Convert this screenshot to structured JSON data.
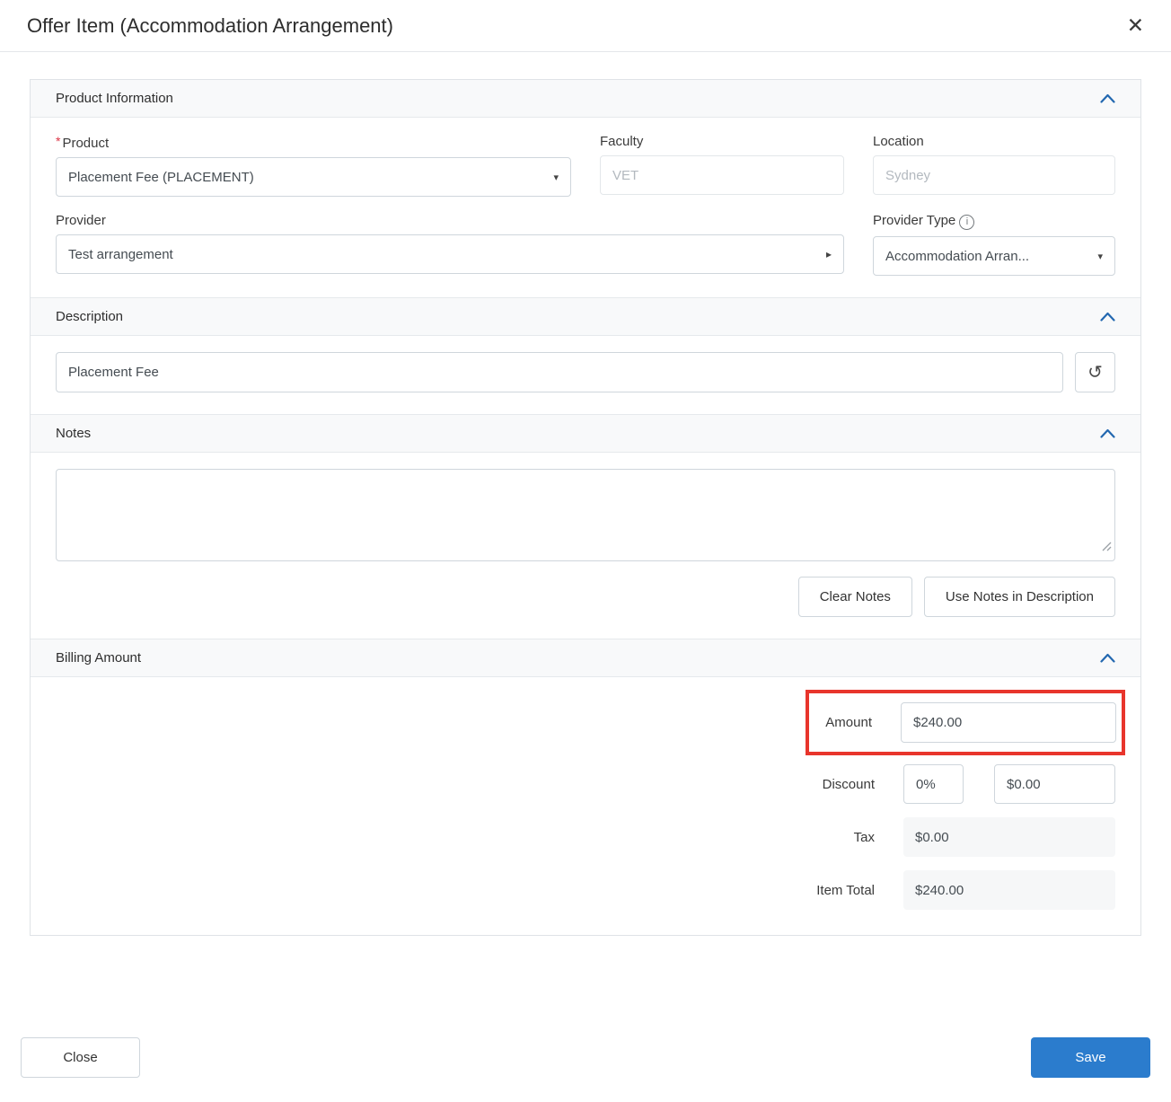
{
  "colors": {
    "accent_blue": "#2b7ccd",
    "chevron_blue": "#2368b0",
    "highlight_red": "#e8352c",
    "section_header_bg": "#f8f9fa"
  },
  "icons": {
    "close": "✕",
    "caret_down": "▾",
    "caret_right": "▸",
    "info": "i",
    "history": "↺"
  },
  "modal": {
    "title": "Offer Item (Accommodation Arrangement)"
  },
  "product_information": {
    "header": "Product Information",
    "product": {
      "label": "Product",
      "required": "*",
      "value": "Placement Fee (PLACEMENT)"
    },
    "faculty": {
      "label": "Faculty",
      "value": "VET"
    },
    "location": {
      "label": "Location",
      "value": "Sydney"
    },
    "provider": {
      "label": "Provider",
      "value": "Test arrangement"
    },
    "provider_type": {
      "label": "Provider Type",
      "value": "Accommodation Arran..."
    }
  },
  "description": {
    "header": "Description",
    "value": "Placement Fee"
  },
  "notes": {
    "header": "Notes",
    "value": "",
    "clear_button": "Clear Notes",
    "use_button": "Use Notes in Description"
  },
  "billing": {
    "header": "Billing Amount",
    "amount_label": "Amount",
    "amount_value": "$240.00",
    "discount_label": "Discount",
    "discount_percent": "0%",
    "discount_value": "$0.00",
    "tax_label": "Tax",
    "tax_value": "$0.00",
    "item_total_label": "Item Total",
    "item_total_value": "$240.00"
  },
  "footer": {
    "close_button": "Close",
    "save_button": "Save"
  }
}
